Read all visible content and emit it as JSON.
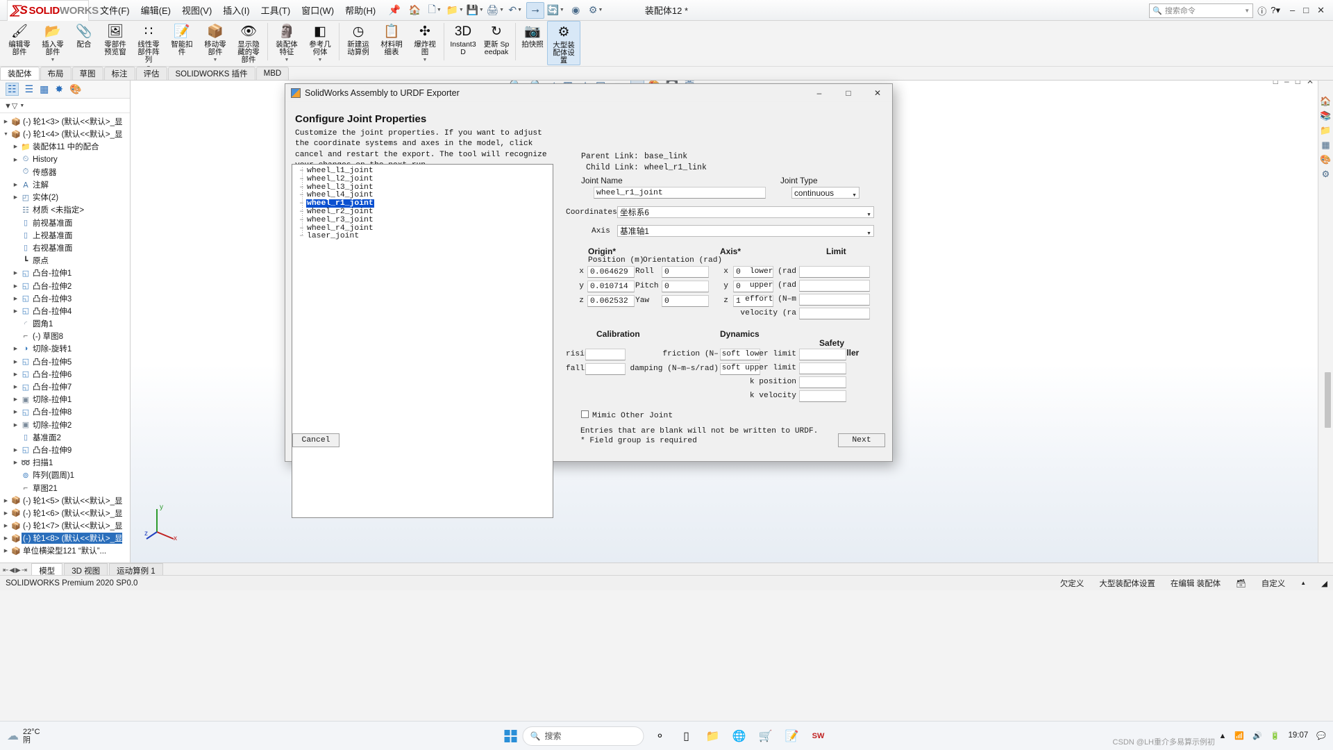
{
  "titlebar": {
    "logo_ds": "ᷞS",
    "logo_solid": "SOLID",
    "logo_works": "WORKS",
    "menus": [
      "文件(F)",
      "编辑(E)",
      "视图(V)",
      "插入(I)",
      "工具(T)",
      "窗口(W)",
      "帮助(H)"
    ],
    "document_title": "装配体12 *",
    "search_placeholder": "搜索命令",
    "window_buttons": [
      "–",
      "□",
      "✕"
    ]
  },
  "ribbon": {
    "items": [
      {
        "label": "编辑零部件",
        "icon": "edit-component-icon",
        "dropdown": false
      },
      {
        "label": "插入零部件",
        "icon": "insert-component-icon",
        "dropdown": true
      },
      {
        "label": "配合",
        "icon": "mate-icon",
        "dropdown": false
      },
      {
        "label": "零部件预览窗",
        "icon": "component-preview-icon",
        "dropdown": false
      },
      {
        "label": "线性零部件阵列",
        "icon": "linear-pattern-icon",
        "dropdown": true
      },
      {
        "label": "智能扣件",
        "icon": "smart-fastener-icon",
        "dropdown": false
      },
      {
        "label": "移动零部件",
        "icon": "move-component-icon",
        "dropdown": true
      },
      {
        "label": "显示隐藏的零部件",
        "icon": "show-hidden-components-icon",
        "dropdown": false
      },
      {
        "label": "装配体特征",
        "icon": "assembly-feature-icon",
        "dropdown": true
      },
      {
        "label": "参考几何体",
        "icon": "reference-geometry-icon",
        "dropdown": true
      },
      {
        "label": "新建运动算例",
        "icon": "new-motion-study-icon",
        "dropdown": false
      },
      {
        "label": "材料明细表",
        "icon": "bom-icon",
        "dropdown": false
      },
      {
        "label": "爆炸视图",
        "icon": "exploded-view-icon",
        "dropdown": true
      },
      {
        "label": "Instant3D",
        "icon": "instant3d-icon",
        "dropdown": false
      },
      {
        "label": "更新 Speedpak",
        "icon": "update-speedpak-icon",
        "dropdown": false
      },
      {
        "label": "拍快照",
        "icon": "snapshot-icon",
        "dropdown": false
      },
      {
        "label": "大型装配体设置",
        "icon": "large-assembly-settings-icon",
        "dropdown": false,
        "active": true
      }
    ]
  },
  "tabs": {
    "items": [
      "装配体",
      "布局",
      "草图",
      "标注",
      "评估",
      "SOLIDWORKS 插件",
      "MBD"
    ],
    "active_index": 0
  },
  "left_panel": {
    "filter_placeholder": "",
    "tree": [
      {
        "label": "(-) 轮1<3> (默认<<默认>_显",
        "indent": 0,
        "arrow": true,
        "icon": "assembly-part-icon"
      },
      {
        "label": "(-) 轮1<4> (默认<<默认>_显",
        "indent": 0,
        "arrow": "down",
        "icon": "assembly-part-icon"
      },
      {
        "label": "装配体11 中的配合",
        "indent": 1,
        "arrow": true,
        "icon": "mates-folder-icon"
      },
      {
        "label": "History",
        "indent": 1,
        "arrow": true,
        "icon": "history-icon"
      },
      {
        "label": "传感器",
        "indent": 1,
        "arrow": false,
        "icon": "sensors-icon"
      },
      {
        "label": "注解",
        "indent": 1,
        "arrow": true,
        "icon": "annotations-icon"
      },
      {
        "label": "实体(2)",
        "indent": 1,
        "arrow": true,
        "icon": "solid-bodies-icon"
      },
      {
        "label": "材质 <未指定>",
        "indent": 1,
        "arrow": false,
        "icon": "material-icon"
      },
      {
        "label": "前视基准面",
        "indent": 1,
        "arrow": false,
        "icon": "plane-icon"
      },
      {
        "label": "上视基准面",
        "indent": 1,
        "arrow": false,
        "icon": "plane-icon"
      },
      {
        "label": "右视基准面",
        "indent": 1,
        "arrow": false,
        "icon": "plane-icon"
      },
      {
        "label": "原点",
        "indent": 1,
        "arrow": false,
        "icon": "origin-icon"
      },
      {
        "label": "凸台-拉伸1",
        "indent": 1,
        "arrow": true,
        "icon": "boss-extrude-icon"
      },
      {
        "label": "凸台-拉伸2",
        "indent": 1,
        "arrow": true,
        "icon": "boss-extrude-icon"
      },
      {
        "label": "凸台-拉伸3",
        "indent": 1,
        "arrow": true,
        "icon": "boss-extrude-icon"
      },
      {
        "label": "凸台-拉伸4",
        "indent": 1,
        "arrow": true,
        "icon": "boss-extrude-icon"
      },
      {
        "label": "圆角1",
        "indent": 1,
        "arrow": false,
        "icon": "fillet-icon"
      },
      {
        "label": "(-) 草图8",
        "indent": 1,
        "arrow": false,
        "icon": "sketch-icon"
      },
      {
        "label": "切除-旋转1",
        "indent": 1,
        "arrow": true,
        "icon": "cut-revolve-icon"
      },
      {
        "label": "凸台-拉伸5",
        "indent": 1,
        "arrow": true,
        "icon": "boss-extrude-icon"
      },
      {
        "label": "凸台-拉伸6",
        "indent": 1,
        "arrow": true,
        "icon": "boss-extrude-icon"
      },
      {
        "label": "凸台-拉伸7",
        "indent": 1,
        "arrow": true,
        "icon": "boss-extrude-icon"
      },
      {
        "label": "切除-拉伸1",
        "indent": 1,
        "arrow": true,
        "icon": "cut-extrude-icon"
      },
      {
        "label": "凸台-拉伸8",
        "indent": 1,
        "arrow": true,
        "icon": "boss-extrude-icon"
      },
      {
        "label": "切除-拉伸2",
        "indent": 1,
        "arrow": true,
        "icon": "cut-extrude-icon"
      },
      {
        "label": "基准面2",
        "indent": 1,
        "arrow": false,
        "icon": "plane-icon"
      },
      {
        "label": "凸台-拉伸9",
        "indent": 1,
        "arrow": true,
        "icon": "boss-extrude-icon"
      },
      {
        "label": "扫描1",
        "indent": 1,
        "arrow": true,
        "icon": "sweep-icon"
      },
      {
        "label": "阵列(圆周)1",
        "indent": 1,
        "arrow": false,
        "icon": "circular-pattern-icon"
      },
      {
        "label": "草图21",
        "indent": 1,
        "arrow": false,
        "icon": "sketch-icon"
      },
      {
        "label": "(-) 轮1<5> (默认<<默认>_显",
        "indent": 0,
        "arrow": true,
        "icon": "assembly-part-icon"
      },
      {
        "label": "(-) 轮1<6> (默认<<默认>_显",
        "indent": 0,
        "arrow": true,
        "icon": "assembly-part-icon"
      },
      {
        "label": "(-) 轮1<7> (默认<<默认>_显",
        "indent": 0,
        "arrow": true,
        "icon": "assembly-part-icon"
      },
      {
        "label": "(-) 轮1<8> (默认<<默认>_显",
        "indent": 0,
        "arrow": true,
        "icon": "assembly-part-icon",
        "selected": true
      },
      {
        "label": "单位横梁型121 “默认”...",
        "indent": 0,
        "arrow": true,
        "icon": "assembly-part-icon"
      }
    ]
  },
  "dialog": {
    "title": "SolidWorks Assembly to URDF Exporter",
    "window_buttons": [
      "–",
      "□",
      "✕"
    ],
    "heading": "Configure Joint Properties",
    "description": "Customize the joint properties. If you want to adjust the coordinate systems and axes in the model, click cancel and restart the export. The tool will recognize your changes on the next run.",
    "joint_list": [
      {
        "name": "wheel_l1_joint",
        "selected": false
      },
      {
        "name": "wheel_l2_joint",
        "selected": false
      },
      {
        "name": "wheel_l3_joint",
        "selected": false
      },
      {
        "name": "wheel_l4_joint",
        "selected": false
      },
      {
        "name": "wheel_r1_joint",
        "selected": true
      },
      {
        "name": "wheel_r2_joint",
        "selected": false
      },
      {
        "name": "wheel_r3_joint",
        "selected": false
      },
      {
        "name": "wheel_r4_joint",
        "selected": false
      },
      {
        "name": "laser_joint",
        "selected": false
      }
    ],
    "parent_link_label": "Parent Link:",
    "parent_link_value": "base_link",
    "child_link_label": "Child Link:",
    "child_link_value": "wheel_r1_link",
    "joint_name_label": "Joint Name",
    "joint_name_value": "wheel_r1_joint",
    "joint_type_label": "Joint Type",
    "joint_type_value": "continuous",
    "coordinates_label": "Coordinates",
    "coordinates_value": "坐标系6",
    "axis_select_label": "Axis",
    "axis_select_value": "基准轴1",
    "origin_group": "Origin*",
    "position_header": "Position (m)",
    "orientation_header": "Orientation (rad)",
    "position": [
      {
        "label": "x",
        "value": "0.064629"
      },
      {
        "label": "y",
        "value": "0.010714"
      },
      {
        "label": "z",
        "value": "0.062532"
      }
    ],
    "orientation": [
      {
        "label": "Roll",
        "value": "0"
      },
      {
        "label": "Pitch",
        "value": "0"
      },
      {
        "label": "Yaw",
        "value": "0"
      }
    ],
    "axis_group": "Axis*",
    "axis": [
      {
        "label": "x",
        "value": "0"
      },
      {
        "label": "y",
        "value": "0"
      },
      {
        "label": "z",
        "value": "1"
      }
    ],
    "limit_group": "Limit",
    "limit": [
      {
        "label": "lower (rad",
        "value": ""
      },
      {
        "label": "upper (rad",
        "value": ""
      },
      {
        "label": "effort (N–m",
        "value": ""
      },
      {
        "label": "velocity (ra",
        "value": ""
      }
    ],
    "calibration_group": "Calibration",
    "calibration": [
      {
        "label": "rising",
        "value": ""
      },
      {
        "label": "falling",
        "value": ""
      }
    ],
    "dynamics_group": "Dynamics",
    "dynamics": [
      {
        "label": "friction (N–",
        "value": ""
      },
      {
        "label": "damping (N–m–s/rad)",
        "value": ""
      }
    ],
    "safety_group": "Safety Controller",
    "safety": [
      {
        "label": "soft lower limit",
        "value": ""
      },
      {
        "label": "soft upper limit",
        "value": ""
      },
      {
        "label": "k position",
        "value": ""
      },
      {
        "label": "k velocity",
        "value": ""
      }
    ],
    "mimic_label": "Mimic Other Joint",
    "mimic_checked": false,
    "footer_note_1": "Entries that are blank will not be written to URDF.",
    "footer_note_2": "* Field group is required",
    "cancel_label": "Cancel",
    "next_label": "Next"
  },
  "bottom_tabs": {
    "items": [
      "模型",
      "3D 视图",
      "运动算例 1"
    ],
    "active_index": 0
  },
  "statusbar": {
    "left": "SOLIDWORKS Premium 2020 SP0.0",
    "items": [
      "欠定义",
      "大型装配体设置",
      "在编辑 装配体",
      "自定义"
    ]
  },
  "taskbar": {
    "weather_temp": "22°C",
    "weather_desc": "阴",
    "search_placeholder": "搜索",
    "clock_time": "19:07",
    "watermark": "CSDN @LH重介多易算示例初"
  }
}
